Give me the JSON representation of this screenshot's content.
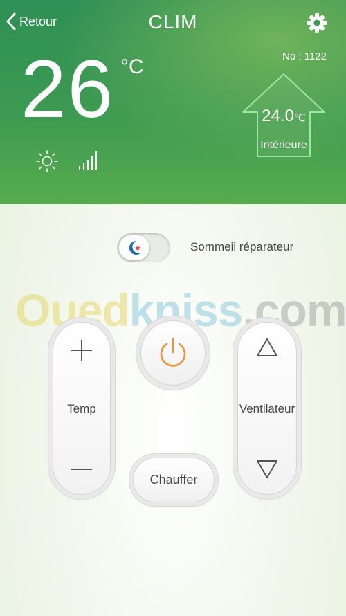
{
  "header": {
    "back_label": "Retour",
    "title": "CLIM",
    "device_no": "No : 1122"
  },
  "status": {
    "set_temperature": "26",
    "unit": "°C",
    "mode_icon": "sun-icon",
    "fan_icon": "signal-bars-icon"
  },
  "indoor": {
    "temperature": "24.0",
    "unit": "℃",
    "label": "Intérieure"
  },
  "sleep": {
    "label": "Sommeil réparateur",
    "enabled": false
  },
  "controls": {
    "temp_label": "Temp",
    "fan_label": "Ventilateur",
    "heat_label": "Chauffer",
    "power_icon": "power-icon"
  },
  "watermark": {
    "part1": "Oued",
    "part2": "kniss",
    "part3": ".com"
  },
  "colors": {
    "header_green": "#3c9a52",
    "power_orange": "#e8953a",
    "heart_red": "#e0405a",
    "moon_blue": "#1f6fb0"
  }
}
